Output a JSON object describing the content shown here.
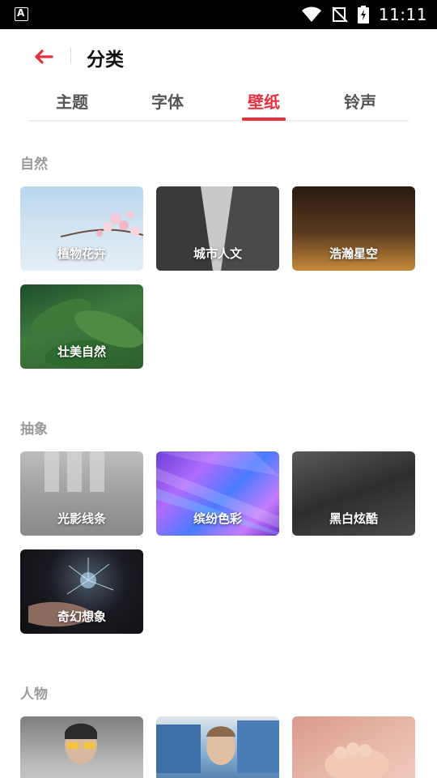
{
  "status_bar": {
    "time": "11:11",
    "left_icon": "A"
  },
  "header": {
    "title": "分类"
  },
  "tabs": [
    {
      "label": "主题"
    },
    {
      "label": "字体"
    },
    {
      "label": "壁纸",
      "active": true
    },
    {
      "label": "铃声"
    }
  ],
  "sections": [
    {
      "title": "自然",
      "items": [
        "植物花卉",
        "城市人文",
        "浩瀚星空",
        "壮美自然"
      ]
    },
    {
      "title": "抽象",
      "items": [
        "光影线条",
        "缤纷色彩",
        "黑白炫酷",
        "奇幻想象"
      ]
    },
    {
      "title": "人物",
      "items": [
        "",
        "",
        ""
      ]
    }
  ],
  "colors": {
    "accent": "#e5303e",
    "section_title": "#9a9a9a",
    "tab_inactive": "#555555"
  },
  "icons": {
    "back": "arrow-left-icon",
    "wifi": "wifi-icon",
    "signal": "no-signal-icon",
    "battery": "battery-charging-icon"
  }
}
